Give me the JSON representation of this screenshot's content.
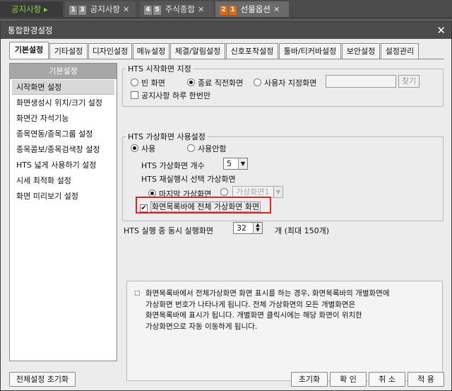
{
  "top_tabs": [
    {
      "label": "공지사항 ▸",
      "num": ""
    },
    {
      "label": "공지사항",
      "num": "1 3"
    },
    {
      "label": "주식종합",
      "num": "4 5"
    },
    {
      "label": "선물옵션",
      "num": "2 1"
    }
  ],
  "dialog": {
    "title": "통합환경설정",
    "close": "✕"
  },
  "settings_tabs": [
    "기본설정",
    "기타설정",
    "디자인설정",
    "메뉴설정",
    "체결/알림설정",
    "신호포착설정",
    "툴바/티커바설정",
    "보안설정",
    "설정관리"
  ],
  "left": {
    "header": "기본설정",
    "items": [
      "시작화면 설정",
      "화면생성시 위치/크기 설정",
      "화면간 자석기능",
      "종목연동/종목그룹 설정",
      "종목콤보/종목검색창 설정",
      "HTS 넓게 사용하기 설정",
      "시세 최적화 설정",
      "화면 미리보기 설정"
    ]
  },
  "start_group": {
    "legend": "HTS 시작화면 지정",
    "opt_blank": "빈 화면",
    "opt_last": "종료 직전화면",
    "opt_user": "사용자 지정화면",
    "find_button": "찾기",
    "notice_once": "공지사항 하루 한번만"
  },
  "virtual_group": {
    "legend": "HTS 가상화면 사용설정",
    "opt_use": "사용",
    "opt_nouse": "사용안함",
    "count_label": "HTS 가상화면 개수",
    "count_value": "5",
    "rerun_label": "HTS 재실행시 선택 가상화면",
    "opt_last_virtual": "마지막 가상화면",
    "virtual_combo": "가상화면1",
    "show_all_label": "화면목록바에 전체 가상화면 화면"
  },
  "concurrent": {
    "label": "HTS 실행 중 동시 실행화면",
    "value": "32",
    "suffix": "개 (최대 150개)"
  },
  "info_text": "화면목록바에서 전체가상화면 화면 표시를 하는 경우, 화면목록바의 개별화면에\n가상화면 번호가 나타나게 됩니다. 전체 가상화면의 모든 개별화면은\n화면목록바에 표시가 됩니다. 개별화면 클릭시에는 해당 화면이 위치한\n가상화면으로 자동 이동하게 됩니다.",
  "buttons": {
    "reset_all": "전체설정 초기화",
    "reset": "초기화",
    "ok": "확 인",
    "cancel": "취 소",
    "apply": "적 용"
  }
}
